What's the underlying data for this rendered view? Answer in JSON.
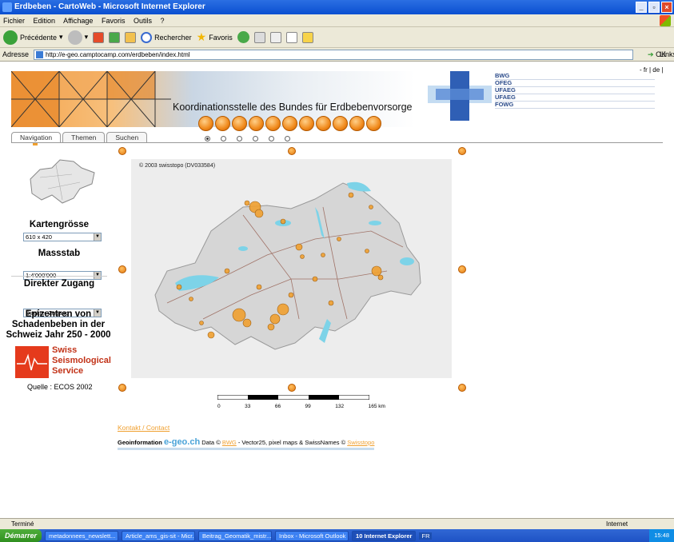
{
  "window": {
    "title": "Erdbeben - CartoWeb - Microsoft Internet Explorer"
  },
  "menu": [
    "Fichier",
    "Edition",
    "Affichage",
    "Favoris",
    "Outils",
    "?"
  ],
  "toolbar": {
    "back": "Précédente",
    "search": "Rechercher",
    "favorites": "Favoris"
  },
  "address": {
    "label": "Adresse",
    "url": "http://e-geo.camptocamp.com/erdbeben/index.html",
    "ok": "OK",
    "links": "Links"
  },
  "header": {
    "title": "Koordinationsstelle des Bundes für Erdbebenvorsorge",
    "agencies": [
      "BWG",
      "OFEG",
      "UFAEG",
      "UFAEG",
      "FOWG"
    ],
    "lang": "- fr | de |"
  },
  "tabs": [
    "Navigation",
    "Themen",
    "Suchen"
  ],
  "sidebar": {
    "map_size_label": "Kartengrösse",
    "map_size_value": "610 x 420",
    "scale_label": "Massstab",
    "scale_value": "1:4'000'000",
    "direct_label": "Direkter Zugang",
    "direct_value": "Direkter Zugang",
    "epicenters": "Epizentren von Schadenbeben in der Schweiz Jahr 250 - 2000",
    "sso_line1": "Swiss",
    "sso_line2": "Seismological",
    "sso_line3": "Service",
    "source": "Quelle : ECOS 2002"
  },
  "map": {
    "copyright": "© 2003 swisstopo (DV033584)"
  },
  "scale": {
    "ticks": [
      "0",
      "33",
      "66",
      "99",
      "132",
      "165 km"
    ]
  },
  "footer": {
    "contact": "Kontakt / Contact",
    "geo_prefix": "Geoinformation",
    "geo_logo": "e-geo.ch",
    "data_text": "Data ©",
    "bwg": "BWG",
    "mid_text": "- Vector25, pixel maps & SwissNames ©",
    "swisstopo": "Swisstopo"
  },
  "status": {
    "left": "Terminé",
    "zone": "Internet"
  },
  "taskbar": {
    "start": "Démarrer",
    "tasks": [
      "metadonnees_newslett...",
      "Article_ams_gis-sit - Micr...",
      "Beitrag_Geomatik_mistr...",
      "Inbox - Microsoft Outlook",
      "10 Internet Explorer"
    ],
    "lang": "FR",
    "clock": "15:48"
  },
  "colors": {
    "accent": "#f0a030",
    "titlebar": "#0a4fd0",
    "lakes": "#7dd3e8"
  }
}
